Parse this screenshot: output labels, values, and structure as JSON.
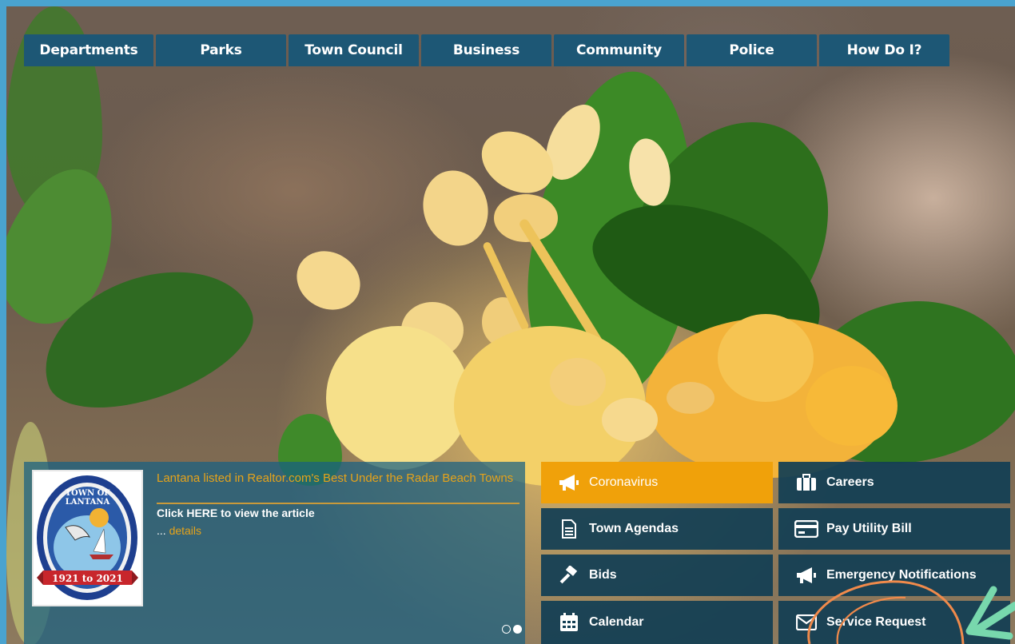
{
  "nav": {
    "items": [
      {
        "label": "Departments"
      },
      {
        "label": "Parks"
      },
      {
        "label": "Town Council"
      },
      {
        "label": "Business"
      },
      {
        "label": "Community"
      },
      {
        "label": "Police"
      },
      {
        "label": "How Do I?"
      }
    ]
  },
  "news": {
    "title": "Lantana listed in Realtor.com's Best Under the Radar Beach Towns",
    "body": "Click HERE to view the article",
    "details_prefix": "...",
    "details_label": "details",
    "seal": {
      "top_text": "TOWN OF LANTANA",
      "banner_text": "1921 to 2021"
    }
  },
  "quick_links": [
    {
      "label": "Coronavirus",
      "icon": "megaphone-icon"
    },
    {
      "label": "Careers",
      "icon": "briefcase-icon"
    },
    {
      "label": "Town Agendas",
      "icon": "document-icon"
    },
    {
      "label": "Pay Utility Bill",
      "icon": "credit-card-icon"
    },
    {
      "label": "Bids",
      "icon": "gavel-icon"
    },
    {
      "label": "Emergency Notifications",
      "icon": "megaphone-icon"
    },
    {
      "label": "Calendar",
      "icon": "calendar-icon"
    },
    {
      "label": "Service Request",
      "icon": "envelope-icon"
    }
  ],
  "colors": {
    "nav_bg": "#1d5775",
    "accent_orange": "#f0a10a",
    "news_title": "#e6a31a",
    "frame_blue": "#4aa3cf",
    "annotation_orange": "#f08a4b",
    "annotation_green": "#78d8ad"
  }
}
